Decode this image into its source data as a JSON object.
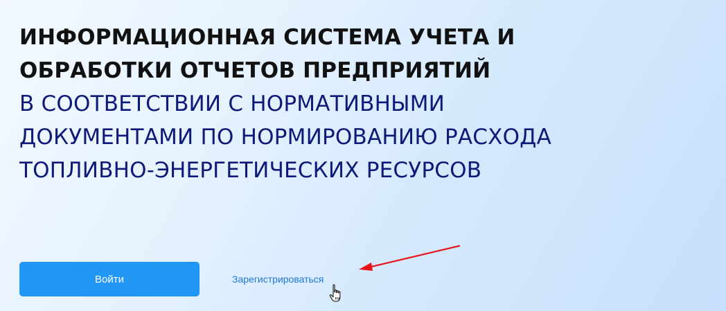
{
  "hero": {
    "title_lines": [
      "ИНФОРМАЦИОННАЯ СИСТЕМА УЧЕТА И",
      "ОБРАБОТКИ ОТЧЕТОВ ПРЕДПРИЯТИЙ"
    ],
    "subtitle_lines": [
      "В СООТВЕТСТВИИ С НОРМАТИВНЫМИ",
      "ДОКУМЕНТАМИ ПО НОРМИРОВАНИЮ РАСХОДА",
      "ТОПЛИВНО-ЭНЕРГЕТИЧЕСКИХ РЕСУРСОВ"
    ]
  },
  "actions": {
    "login_label": "Войти",
    "register_label": "Зарегистрироваться"
  },
  "colors": {
    "title": "#111111",
    "subtitle": "#0e1a7a",
    "button_bg": "#2196f3",
    "link": "#2079d8",
    "annotation_arrow": "#e8141c"
  },
  "icons": {
    "annotation": "red-arrow-icon",
    "pointer": "hand-cursor-icon"
  }
}
